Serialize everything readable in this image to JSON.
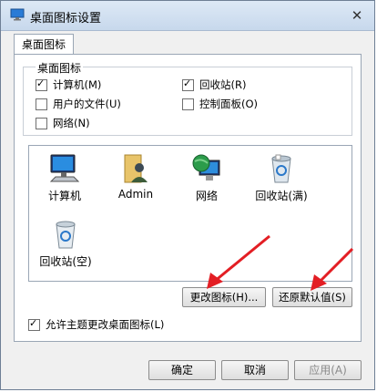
{
  "window": {
    "title": "桌面图标设置",
    "close_label": "✕"
  },
  "tabs": [
    {
      "label": "桌面图标"
    }
  ],
  "desktop_icons_group": {
    "legend": "桌面图标",
    "checkboxes": [
      {
        "label": "计算机(M)",
        "checked": true
      },
      {
        "label": "回收站(R)",
        "checked": true
      },
      {
        "label": "用户的文件(U)",
        "checked": false
      },
      {
        "label": "控制面板(O)",
        "checked": false
      },
      {
        "label": "网络(N)",
        "checked": false
      }
    ]
  },
  "icon_list": [
    {
      "label": "计算机",
      "icon": "computer-icon"
    },
    {
      "label": "Admin",
      "icon": "user-folder-icon"
    },
    {
      "label": "网络",
      "icon": "network-globe-icon"
    },
    {
      "label": "回收站(满)",
      "icon": "recycle-bin-full-icon"
    },
    {
      "label": "回收站(空)",
      "icon": "recycle-bin-empty-icon"
    }
  ],
  "buttons": {
    "change_icon": "更改图标(H)...",
    "restore_default": "还原默认值(S)"
  },
  "allow_themes": {
    "label": "允许主题更改桌面图标(L)",
    "checked": true
  },
  "footer": {
    "ok": "确定",
    "cancel": "取消",
    "apply": "应用(A)"
  }
}
